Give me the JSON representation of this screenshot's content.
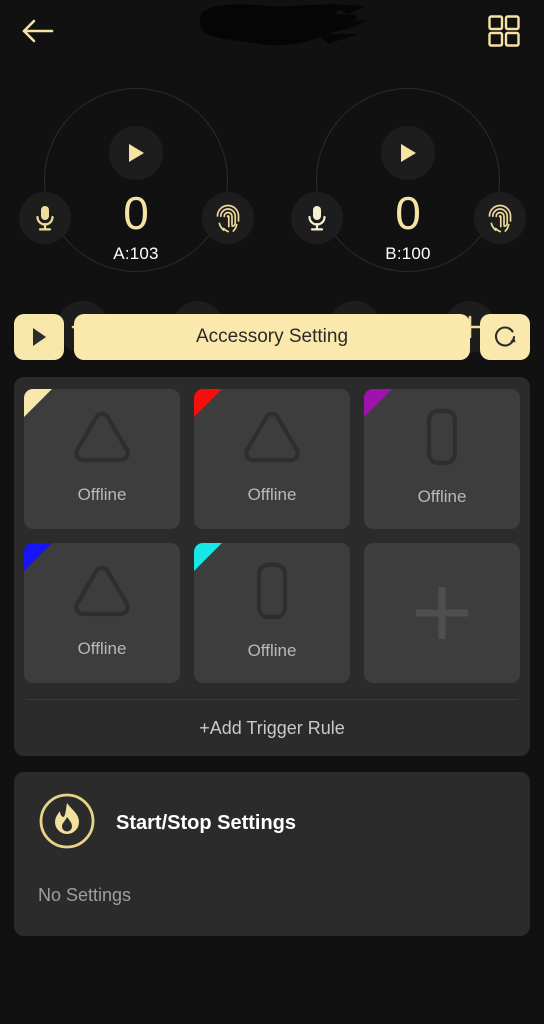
{
  "header": {
    "back_icon": "arrow-left-icon",
    "title": "",
    "title_redacted": true,
    "grid_icon": "grid-menu-icon"
  },
  "dials": [
    {
      "id": "A",
      "value": "0",
      "label": "A:103",
      "play_icon": "play-icon",
      "mic_icon": "microphone-icon",
      "fingerprint_icon": "fingerprint-icon",
      "minus_label": "−",
      "plus_label": "+"
    },
    {
      "id": "B",
      "value": "0",
      "label": "B:100",
      "play_icon": "play-icon",
      "mic_icon": "microphone-icon",
      "fingerprint_icon": "fingerprint-icon",
      "minus_label": "−",
      "plus_label": "+"
    }
  ],
  "accessory_bar": {
    "play_icon": "play-icon",
    "label": "Accessory Setting",
    "refresh_icon": "refresh-icon"
  },
  "devices": {
    "cards": [
      {
        "corner_color": "#f8e7ab",
        "shape": "triangle",
        "status": "Offline"
      },
      {
        "corner_color": "#f90c0c",
        "shape": "triangle",
        "status": "Offline"
      },
      {
        "corner_color": "#a012ad",
        "shape": "pill",
        "status": "Offline"
      },
      {
        "corner_color": "#1515f5",
        "shape": "triangle",
        "status": "Offline"
      },
      {
        "corner_color": "#16e7e7",
        "shape": "pill",
        "status": "Offline"
      }
    ],
    "add_card": {
      "icon": "plus-icon"
    },
    "trigger_rule_label": "+Add Trigger Rule"
  },
  "start_stop": {
    "icon": "flame-circle-icon",
    "title": "Start/Stop Settings",
    "subtitle": "No Settings"
  },
  "colors": {
    "accent_gold": "#f8e7ab",
    "background": "#111111",
    "panel": "#2b2b2b",
    "card": "#3d3d3d",
    "text_muted": "#b9b9b9"
  }
}
